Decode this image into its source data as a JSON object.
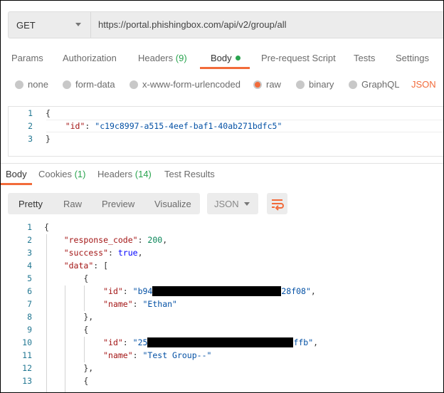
{
  "request": {
    "method": "GET",
    "url": "https://portal.phishingbox.com/api/v2/group/all"
  },
  "tabs": {
    "params": "Params",
    "authorization": "Authorization",
    "headers": "Headers",
    "headers_count": "(9)",
    "body": "Body",
    "prerequest": "Pre-request Script",
    "tests": "Tests",
    "settings": "Settings"
  },
  "body_types": {
    "none": "none",
    "form_data": "form-data",
    "urlencoded": "x-www-form-urlencoded",
    "raw": "raw",
    "binary": "binary",
    "graphql": "GraphQL",
    "format": "JSON"
  },
  "request_body": [
    [
      [
        "p",
        "{"
      ]
    ],
    [
      [
        "p",
        "    "
      ],
      [
        "k",
        "\"id\""
      ],
      [
        "p",
        ": "
      ],
      [
        "s",
        "\"c19c8997-a515-4eef-baf1-40ab271bdfc5\""
      ]
    ],
    [
      [
        "p",
        "}"
      ]
    ]
  ],
  "response_tabs": {
    "body": "Body",
    "cookies": "Cookies",
    "cookies_count": "(1)",
    "headers": "Headers",
    "headers_count": "(14)",
    "test_results": "Test Results"
  },
  "view_modes": {
    "pretty": "Pretty",
    "raw": "Raw",
    "preview": "Preview",
    "visualize": "Visualize",
    "format": "JSON"
  },
  "response_body": [
    [
      [
        "p",
        "{"
      ]
    ],
    [
      [
        "p",
        "    "
      ],
      [
        "k",
        "\"response_code\""
      ],
      [
        "p",
        ": "
      ],
      [
        "n",
        "200"
      ],
      [
        "p",
        ","
      ]
    ],
    [
      [
        "p",
        "    "
      ],
      [
        "k",
        "\"success\""
      ],
      [
        "p",
        ": "
      ],
      [
        "b",
        "true"
      ],
      [
        "p",
        ","
      ]
    ],
    [
      [
        "p",
        "    "
      ],
      [
        "k",
        "\"data\""
      ],
      [
        "p",
        ": ["
      ]
    ],
    [
      [
        "p",
        "        {"
      ]
    ],
    [
      [
        "p",
        "            "
      ],
      [
        "k",
        "\"id\""
      ],
      [
        "p",
        ": "
      ],
      [
        "s",
        "\"b94"
      ],
      [
        "x",
        "181"
      ],
      [
        "s",
        "28f08\""
      ],
      [
        "p",
        ","
      ]
    ],
    [
      [
        "p",
        "            "
      ],
      [
        "k",
        "\"name\""
      ],
      [
        "p",
        ": "
      ],
      [
        "s",
        "\"Ethan\""
      ]
    ],
    [
      [
        "p",
        "        },"
      ]
    ],
    [
      [
        "p",
        "        {"
      ]
    ],
    [
      [
        "p",
        "            "
      ],
      [
        "k",
        "\"id\""
      ],
      [
        "p",
        ": "
      ],
      [
        "s",
        "\"25"
      ],
      [
        "x",
        "205"
      ],
      [
        "s",
        "ffb\""
      ],
      [
        "p",
        ","
      ]
    ],
    [
      [
        "p",
        "            "
      ],
      [
        "k",
        "\"name\""
      ],
      [
        "p",
        ": "
      ],
      [
        "s",
        "\"Test Group--\""
      ]
    ],
    [
      [
        "p",
        "        },"
      ]
    ],
    [
      [
        "p",
        "        {"
      ]
    ]
  ]
}
